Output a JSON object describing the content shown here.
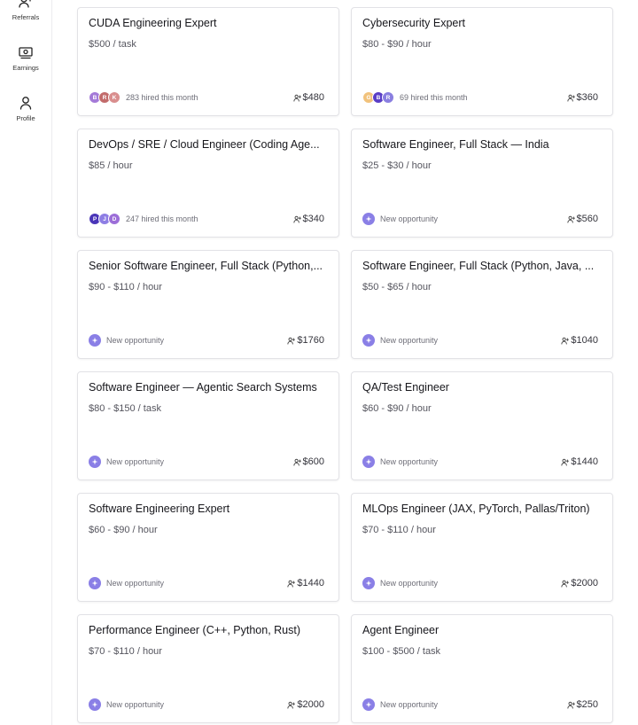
{
  "sidebar": {
    "items": [
      {
        "label": "Referrals",
        "icon": "user-plus-icon"
      },
      {
        "label": "Earnings",
        "icon": "banknote-icon"
      },
      {
        "label": "Profile",
        "icon": "user-icon"
      }
    ]
  },
  "colors": {
    "accent": "#8a7fe6",
    "avatar_colors": [
      "#9b6fd6",
      "#c06a6a",
      "#d98a8a",
      "#f2c17b",
      "#5b3fc4",
      "#7f74d9"
    ]
  },
  "cards": [
    {
      "title": "CUDA Engineering Expert",
      "rate": "$500 / task",
      "footer": "283 hired this month",
      "avatars": [
        {
          "letter": "B",
          "color": "#a47ad8"
        },
        {
          "letter": "R",
          "color": "#c26b6b"
        },
        {
          "letter": "K",
          "color": "#d98e8e"
        }
      ],
      "bonus": "$480"
    },
    {
      "title": "Cybersecurity Expert",
      "rate": "$80 - $90 / hour",
      "footer": "69 hired this month",
      "avatars": [
        {
          "letter": "G",
          "color": "#f1c27c"
        },
        {
          "letter": "B",
          "color": "#5a3ec6"
        },
        {
          "letter": "R",
          "color": "#8a7fe0"
        }
      ],
      "bonus": "$360"
    },
    {
      "title": "DevOps / SRE / Cloud Engineer (Coding Age...",
      "rate": "$85 / hour",
      "footer": "247 hired this month",
      "avatars": [
        {
          "letter": "P",
          "color": "#4a35b8"
        },
        {
          "letter": "J",
          "color": "#8e7ee4"
        },
        {
          "letter": "D",
          "color": "#9c6ed8"
        }
      ],
      "bonus": "$340"
    },
    {
      "title": "Software Engineer, Full Stack — India",
      "rate": "$25 - $30 / hour",
      "footer": "New opportunity",
      "avatars": [],
      "bonus": "$560"
    },
    {
      "title": "Senior Software Engineer, Full Stack (Python,...",
      "rate": "$90 - $110 / hour",
      "footer": "New opportunity",
      "avatars": [],
      "bonus": "$1760"
    },
    {
      "title": "Software Engineer, Full Stack (Python, Java, ...",
      "rate": "$50 - $65 / hour",
      "footer": "New opportunity",
      "avatars": [],
      "bonus": "$1040"
    },
    {
      "title": "Software Engineer — Agentic Search Systems",
      "rate": "$80 - $150 / task",
      "footer": "New opportunity",
      "avatars": [],
      "bonus": "$600"
    },
    {
      "title": "QA/Test Engineer",
      "rate": "$60 - $90 / hour",
      "footer": "New opportunity",
      "avatars": [],
      "bonus": "$1440"
    },
    {
      "title": "Software Engineering Expert",
      "rate": "$60 - $90 / hour",
      "footer": "New opportunity",
      "avatars": [],
      "bonus": "$1440"
    },
    {
      "title": "MLOps Engineer (JAX, PyTorch, Pallas/Triton)",
      "rate": "$70 - $110 / hour",
      "footer": "New opportunity",
      "avatars": [],
      "bonus": "$2000"
    },
    {
      "title": "Performance Engineer (C++, Python, Rust)",
      "rate": "$70 - $110 / hour",
      "footer": "New opportunity",
      "avatars": [],
      "bonus": "$2000"
    },
    {
      "title": "Agent Engineer",
      "rate": "$100 - $500 / task",
      "footer": "New opportunity",
      "avatars": [],
      "bonus": "$250"
    }
  ]
}
